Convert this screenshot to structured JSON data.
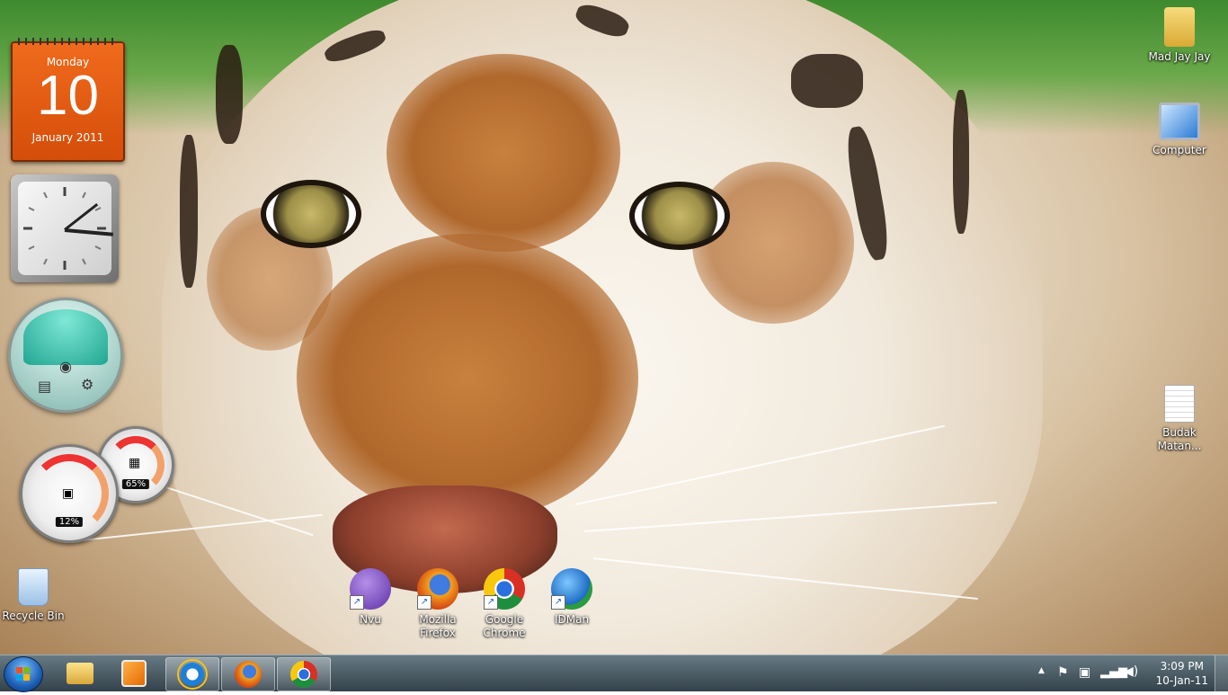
{
  "gadgets": {
    "calendar": {
      "weekday": "Monday",
      "day": "10",
      "month_year": "January 2011"
    },
    "cpu_meter": {
      "cpu_percent": "12%",
      "memory_percent": "65%"
    }
  },
  "desktop_icons": [
    {
      "label": "Mad Jay Jay",
      "icon": "user-folder-icon"
    },
    {
      "label": "Computer",
      "icon": "computer-icon"
    },
    {
      "label": "Budak Matan...",
      "icon": "text-file-icon"
    },
    {
      "label": "Recycle Bin",
      "icon": "recycle-bin-icon"
    },
    {
      "label": "Nvu",
      "icon": "nvu-icon"
    },
    {
      "label": "Mozilla Firefox",
      "icon": "firefox-icon"
    },
    {
      "label": "Google Chrome",
      "icon": "chrome-icon"
    },
    {
      "label": "IDMan",
      "icon": "idman-icon"
    }
  ],
  "taskbar": {
    "pinned": [
      {
        "name": "windows-explorer",
        "icon": "folder-icon"
      },
      {
        "name": "media-player",
        "icon": "media-player-icon"
      },
      {
        "name": "internet-explorer",
        "icon": "ie-icon"
      },
      {
        "name": "firefox",
        "icon": "firefox-icon"
      },
      {
        "name": "chrome",
        "icon": "chrome-icon"
      }
    ],
    "clock": {
      "time": "3:09 PM",
      "date": "10-Jan-11"
    },
    "tray_icons": [
      "show-hidden-icon",
      "action-center-flag-icon",
      "network-device-icon",
      "signal-bars-icon",
      "volume-icon"
    ]
  }
}
